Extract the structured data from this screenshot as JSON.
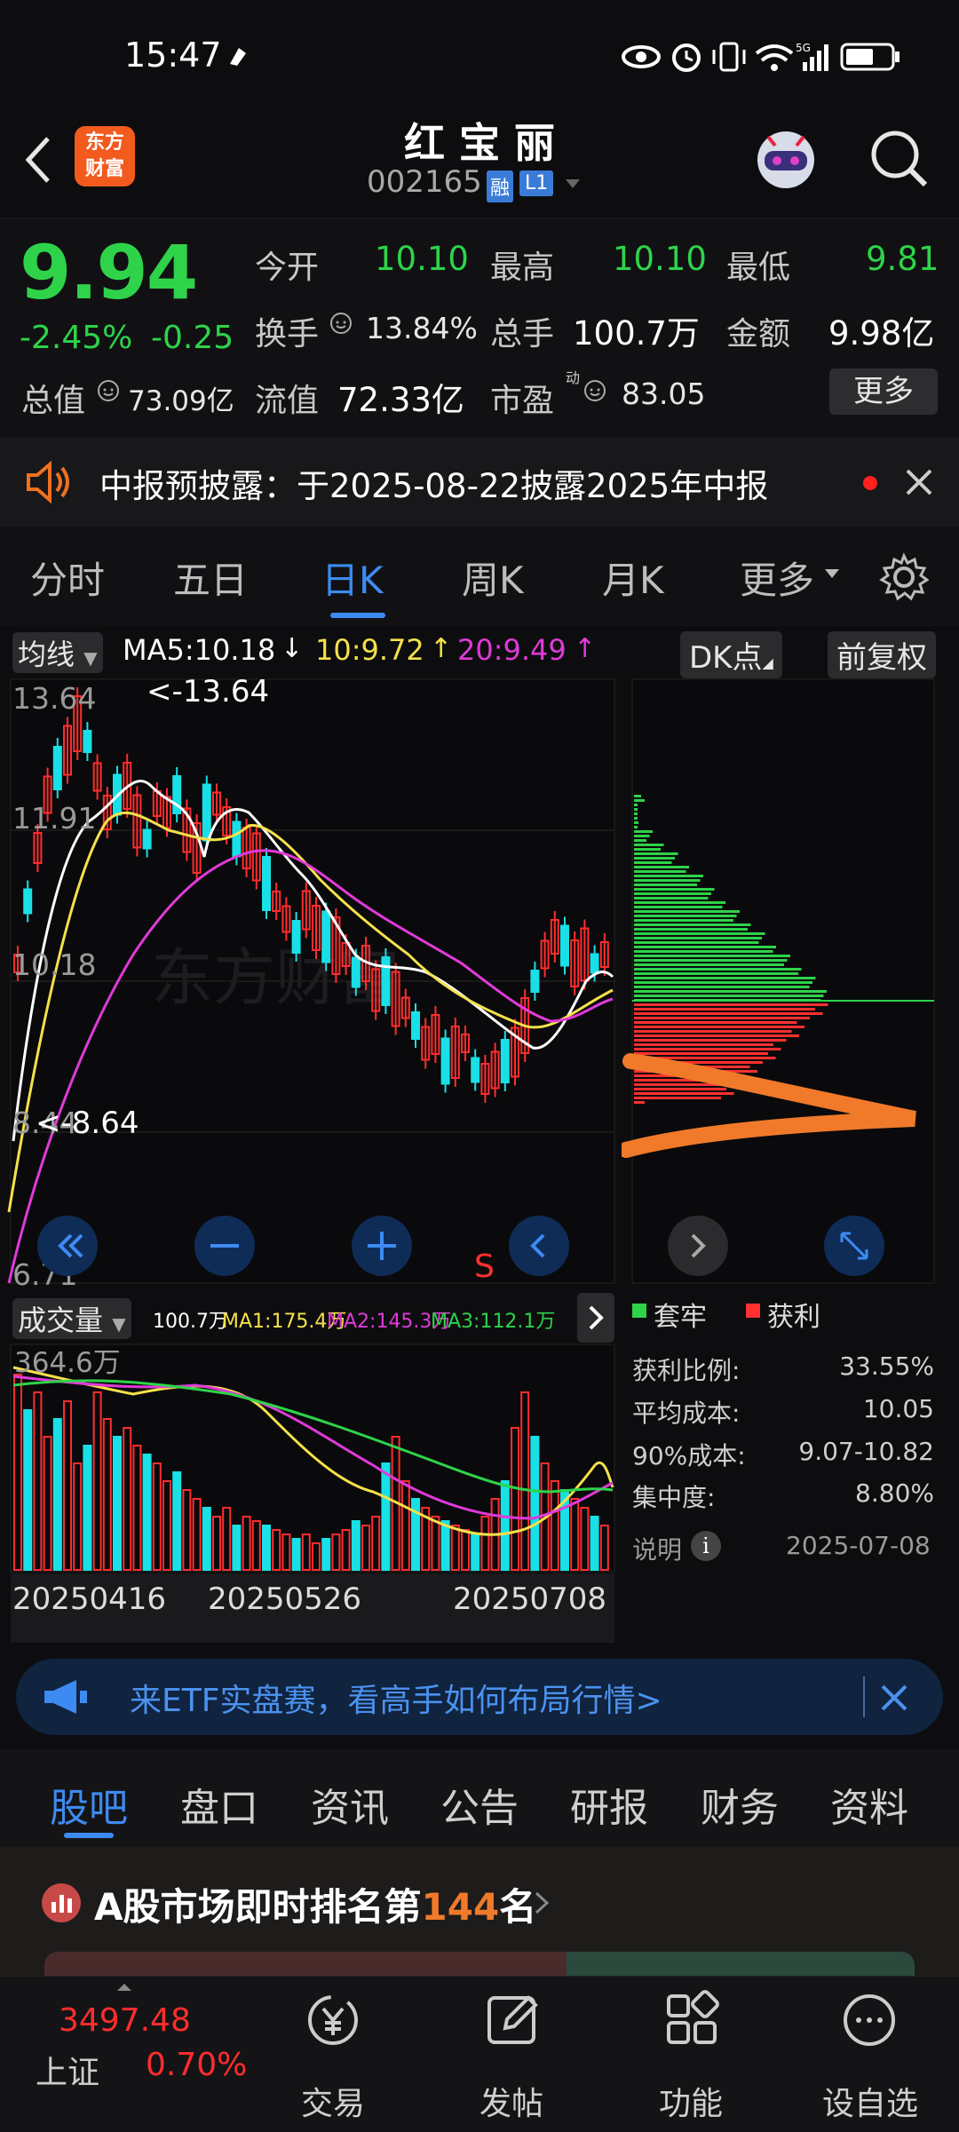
{
  "status": {
    "time": "15:47"
  },
  "header": {
    "logo_line1": "东方",
    "logo_line2": "财富",
    "stock_name": "红 宝 丽",
    "stock_code": "002165",
    "tag_rong": "融",
    "tag_level": "L1"
  },
  "quote": {
    "price": "9.94",
    "change_pct": "-2.45%",
    "change": "-0.25",
    "open_label": "今开",
    "open": "10.10",
    "high_label": "最高",
    "high": "10.10",
    "low_label": "最低",
    "low": "9.81",
    "turnover_label": "换手",
    "turnover": "13.84%",
    "volume_label": "总手",
    "volume": "100.7万",
    "amount_label": "金额",
    "amount": "9.98亿",
    "mktcap_label": "总值",
    "mktcap": "73.09亿",
    "float_label": "流值",
    "float_cap": "72.33亿",
    "pe_label": "市盈",
    "pe_sup": "动",
    "pe": "83.05",
    "more": "更多"
  },
  "notice": {
    "text": "中报预披露：于2025-08-22披露2025年中报"
  },
  "period_tabs": [
    "分时",
    "五日",
    "日K",
    "周K",
    "月K",
    "更多"
  ],
  "period_active": 2,
  "chart": {
    "indicator": "均线",
    "ma5": "MA5:10.18",
    "ma10": "10:9.72",
    "ma20": "20:9.49",
    "dk_button": "DK点",
    "adjust_button": "前复权",
    "y_top": "13.64",
    "y_mid1": "11.91",
    "y_mid2": "10.18",
    "y_low": "8.44",
    "y_bottom": "6.71",
    "max_marker": "<-13.64",
    "min_marker": "<-8.64",
    "sell_marker": "S",
    "watermark": "东方财富",
    "colors": {
      "up": "#ff2d2d",
      "down": "#18e0e6",
      "ma5": "#ffffff",
      "ma10": "#f5e14a",
      "ma20": "#e03ad8"
    }
  },
  "volume": {
    "label": "成交量",
    "current": "100.7万",
    "ma1": "MA1:175.4万",
    "ma2": "MA2:145.3万",
    "ma3": "MA3:112.1万",
    "y_top": "364.6万",
    "dates": [
      "20250416",
      "20250526",
      "20250708"
    ]
  },
  "chips": {
    "legend_trapped": "套牢",
    "legend_profit": "获利",
    "profit_ratio_label": "获利比例:",
    "profit_ratio": "33.55%",
    "avg_cost_label": "平均成本:",
    "avg_cost": "10.05",
    "cost90_label": "90%成本:",
    "cost90": "9.07-10.82",
    "concentration_label": "集中度:",
    "concentration": "8.80%",
    "explain_label": "说明",
    "date": "2025-07-08"
  },
  "ad": {
    "text": "来ETF实盘赛，看高手如何布局行情>"
  },
  "info_tabs": [
    "股吧",
    "盘口",
    "资讯",
    "公告",
    "研报",
    "财务",
    "资料"
  ],
  "info_active": 0,
  "rank": {
    "prefix": "A股市场即时排名第",
    "number": "144",
    "suffix": "名"
  },
  "bottom_nav": {
    "index_value": "3497.48",
    "index_name": "上证",
    "index_change": "0.70%",
    "trade": "交易",
    "post": "发帖",
    "func": "功能",
    "watch": "设自选"
  }
}
